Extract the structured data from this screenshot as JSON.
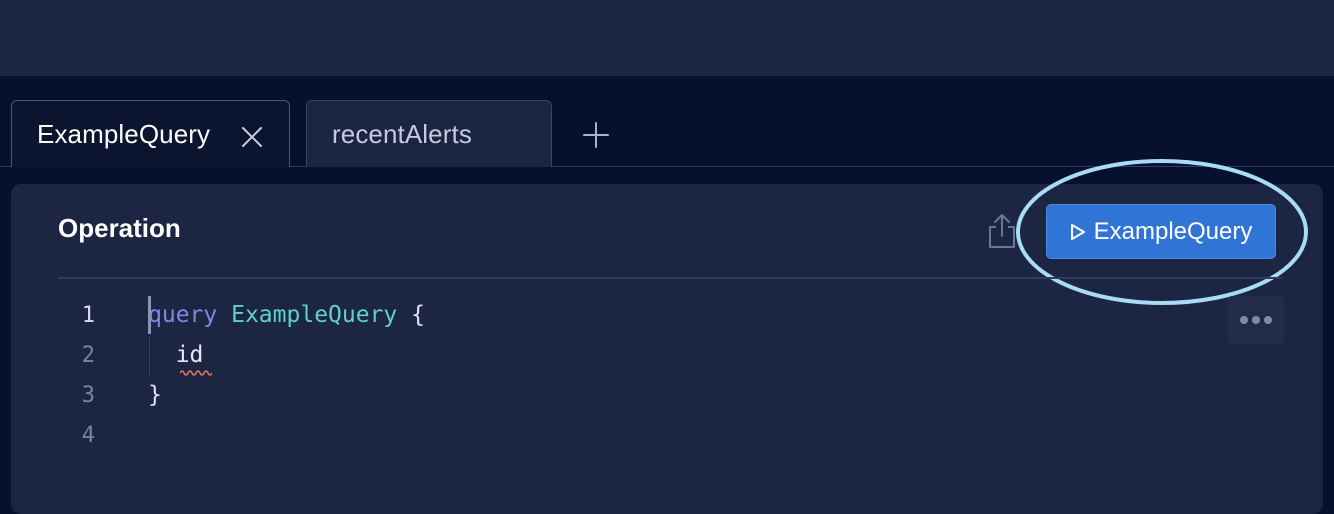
{
  "tabs": [
    {
      "label": "ExampleQuery",
      "active": true,
      "icon": "close-icon"
    },
    {
      "label": "recentAlerts",
      "active": false
    }
  ],
  "add_tab_icon": "plus-icon",
  "operation_panel": {
    "title": "Operation",
    "share_icon": "share-icon",
    "run_button": {
      "label": "ExampleQuery",
      "icon": "play-icon"
    },
    "more_icon": "more-horizontal-icon"
  },
  "editor": {
    "line_numbers": [
      "1",
      "2",
      "3",
      "4"
    ],
    "lines": [
      {
        "keyword": "query",
        "name": "ExampleQuery",
        "brace": "{"
      },
      {
        "field": "id"
      },
      {
        "brace": "}"
      },
      {}
    ]
  },
  "colors": {
    "accent": "#3074d6",
    "highlight": "#a9dcf4",
    "keyword": "#8088e6",
    "operation_name": "#5fd2c2",
    "error_squiggle": "#e0795f"
  }
}
